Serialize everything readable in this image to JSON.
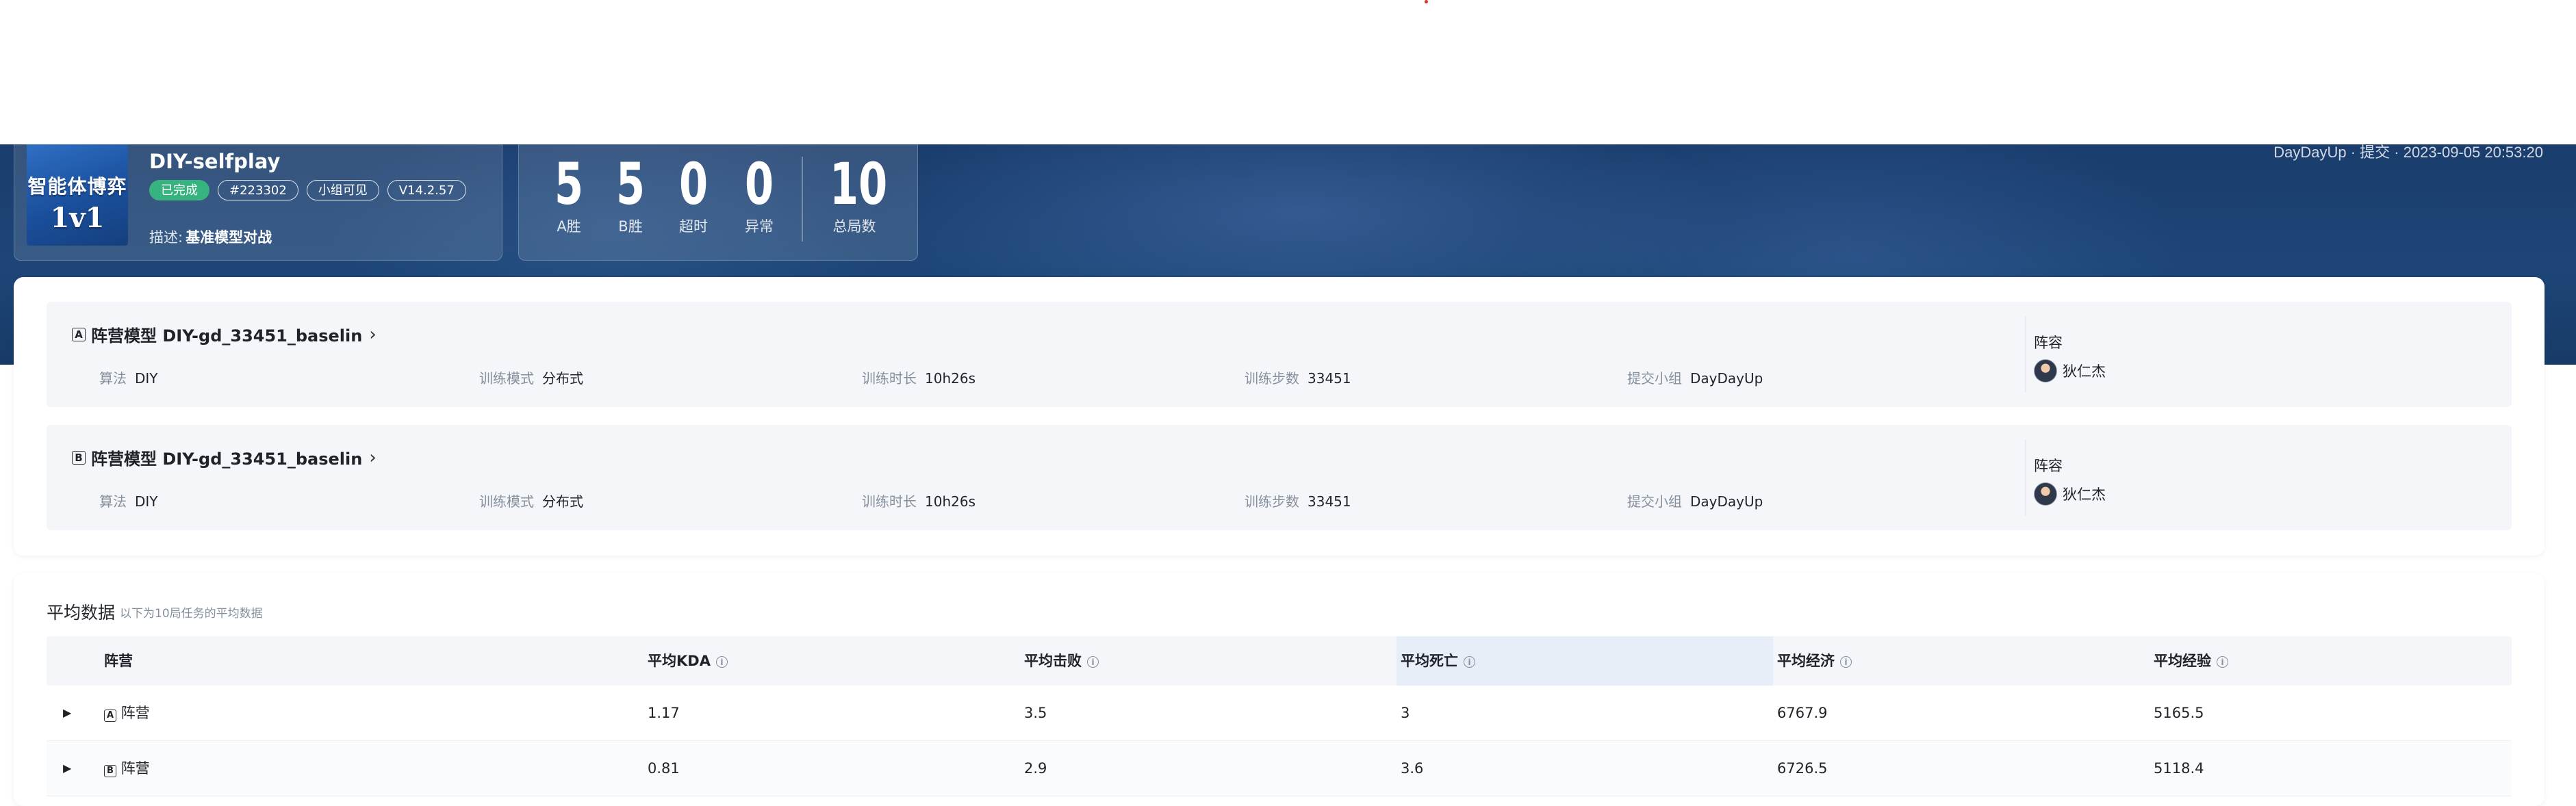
{
  "header": {
    "right_text": "DayDayUp · 提交 · 2023-09-05 20:53:20"
  },
  "match": {
    "cover_line1": "智能体博弈",
    "cover_line2": "1v1",
    "title": "DIY-selfplay",
    "tags": [
      "已完成",
      "#223302",
      "小组可见",
      "V14.2.57"
    ],
    "desc_label": "描述:",
    "desc_value": "基准模型对战"
  },
  "scores": [
    {
      "value": "5",
      "label": "A胜"
    },
    {
      "value": "5",
      "label": "B胜"
    },
    {
      "value": "0",
      "label": "超时"
    },
    {
      "value": "0",
      "label": "异常"
    },
    {
      "value": "10",
      "label": "总局数"
    }
  ],
  "teams": [
    {
      "letter": "A",
      "name": "阵营模型 DIY-gd_33451_baselin",
      "algo_label": "算法",
      "algo": "DIY",
      "mode_label": "训练模式",
      "mode": "分布式",
      "duration_label": "训练时长",
      "duration": "10h26s",
      "steps_label": "训练步数",
      "steps": "33451",
      "group_label": "提交小组",
      "group": "DayDayUp",
      "lineup_label": "阵容",
      "player": "狄仁杰"
    },
    {
      "letter": "B",
      "name": "阵营模型 DIY-gd_33451_baselin",
      "algo_label": "算法",
      "algo": "DIY",
      "mode_label": "训练模式",
      "mode": "分布式",
      "duration_label": "训练时长",
      "duration": "10h26s",
      "steps_label": "训练步数",
      "steps": "33451",
      "group_label": "提交小组",
      "group": "DayDayUp",
      "lineup_label": "阵容",
      "player": "狄仁杰"
    }
  ],
  "avg": {
    "title": "平均数据",
    "subtitle": "以下为10局任务的平均数据",
    "columns": [
      "阵营",
      "平均KDA",
      "平均击败",
      "平均死亡",
      "平均经济",
      "平均经验"
    ],
    "rows": [
      {
        "letter": "A",
        "camp": "阵营",
        "kda": "1.17",
        "kills": "3.5",
        "deaths": "3",
        "gold": "6767.9",
        "exp": "5165.5"
      },
      {
        "letter": "B",
        "camp": "阵营",
        "kda": "0.81",
        "kills": "2.9",
        "deaths": "3.6",
        "gold": "6726.5",
        "exp": "5118.4"
      }
    ]
  }
}
